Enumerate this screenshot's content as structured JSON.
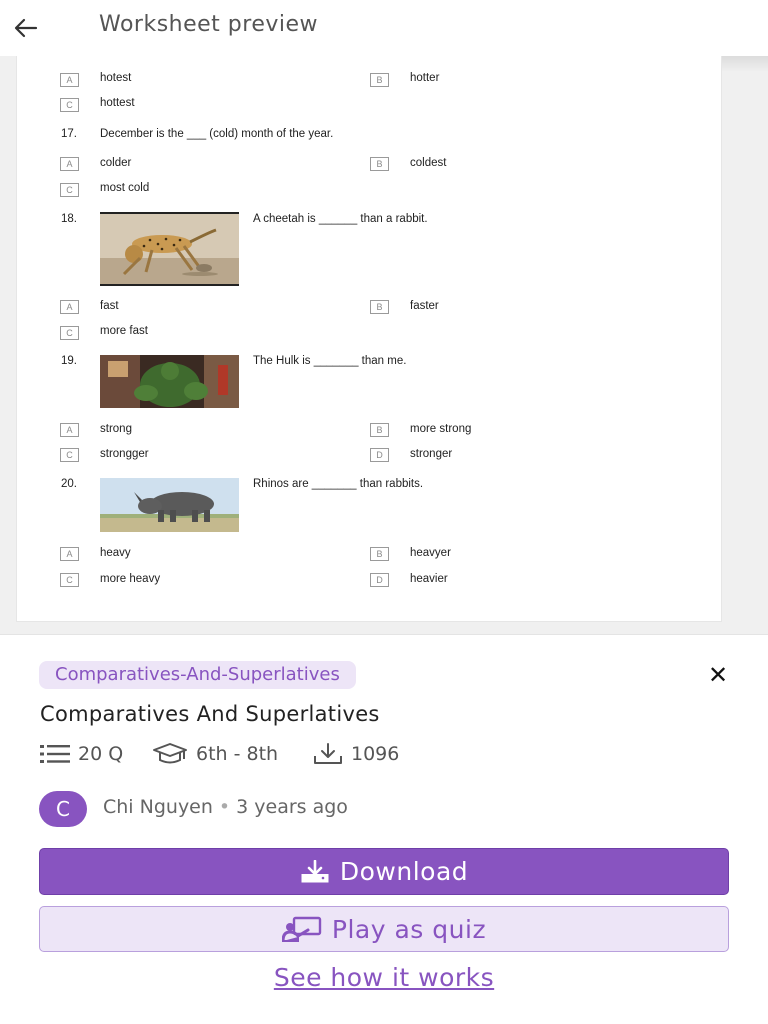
{
  "header": {
    "title": "Worksheet preview"
  },
  "worksheet": {
    "q16_options": [
      {
        "letter": "A",
        "text": "hotest"
      },
      {
        "letter": "B",
        "text": "hotter"
      },
      {
        "letter": "C",
        "text": "hottest"
      }
    ],
    "q17": {
      "number": "17.",
      "text": "December is the ___ (cold) month of the year.",
      "options": [
        {
          "letter": "A",
          "text": "colder"
        },
        {
          "letter": "B",
          "text": "coldest"
        },
        {
          "letter": "C",
          "text": "most cold"
        }
      ]
    },
    "q18": {
      "number": "18.",
      "text": "A cheetah is ______ than a rabbit.",
      "options": [
        {
          "letter": "A",
          "text": "fast"
        },
        {
          "letter": "B",
          "text": "faster"
        },
        {
          "letter": "C",
          "text": "more fast"
        }
      ]
    },
    "q19": {
      "number": "19.",
      "text": "The Hulk is _______ than me.",
      "options": [
        {
          "letter": "A",
          "text": "strong"
        },
        {
          "letter": "B",
          "text": "more strong"
        },
        {
          "letter": "C",
          "text": "strongger"
        },
        {
          "letter": "D",
          "text": "stronger"
        }
      ]
    },
    "q20": {
      "number": "20.",
      "text": "Rhinos are _______ than rabbits.",
      "options": [
        {
          "letter": "A",
          "text": "heavy"
        },
        {
          "letter": "B",
          "text": "heavyer"
        },
        {
          "letter": "C",
          "text": "more heavy"
        },
        {
          "letter": "D",
          "text": "heavier"
        }
      ]
    }
  },
  "panel": {
    "tag": "Comparatives-And-Superlatives",
    "title": "Comparatives And Superlatives",
    "questions": "20 Q",
    "grades": "6th - 8th",
    "downloads": "1096",
    "author_initial": "C",
    "author": "Chi Nguyen",
    "separator": "•",
    "time_ago": "3 years ago",
    "download_label": "Download",
    "play_label": "Play as quiz",
    "how_label": "See how it works"
  },
  "colors": {
    "accent": "#8854c0",
    "accent_light": "#ede5f7"
  },
  "icons": [
    "back-arrow-icon",
    "close-icon",
    "list-icon",
    "graduation-cap-icon",
    "download-tray-icon",
    "download-icon",
    "present-icon"
  ]
}
